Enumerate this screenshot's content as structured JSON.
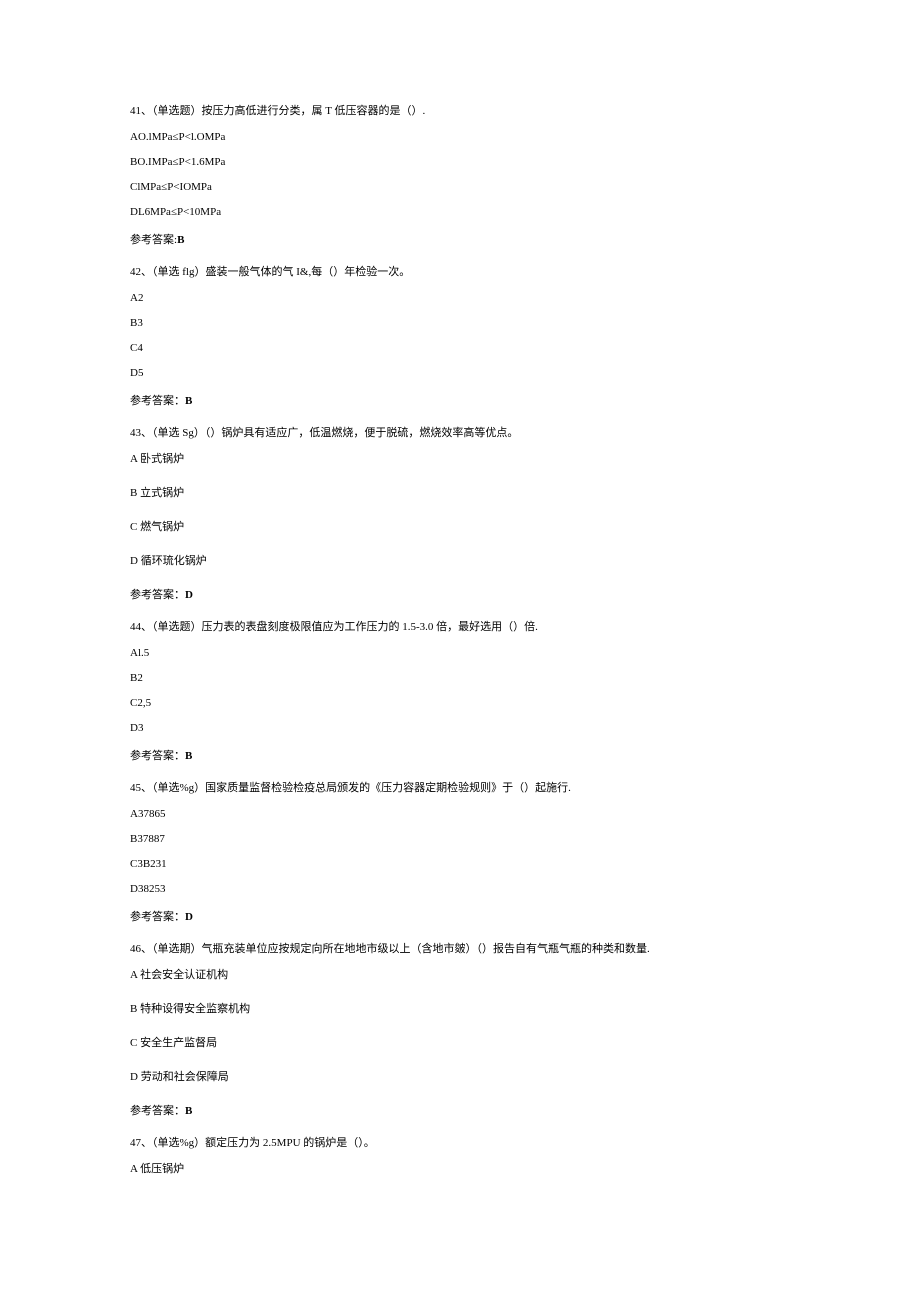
{
  "questions": [
    {
      "number": "41、",
      "type": "（单选题）",
      "text": "按压力高低进行分类，属 T 低压容器的是（）.",
      "options": [
        "AO.lMPa≤P<l.OMPa",
        "BO.IMPa≤P<1.6MPa",
        "ClMPa≤P<IOMPa",
        "DL6MPa≤P<10MPa"
      ],
      "answerLabel": "参考答案:",
      "answer": "B",
      "spaced": false
    },
    {
      "number": "42、",
      "type": "（单选 flg）",
      "text": "盛装一般气体的气 I&,每（）年检验一次。",
      "options": [
        "A2",
        "B3",
        "C4",
        "D5"
      ],
      "answerLabel": "参考答案：",
      "answer": "B",
      "spaced": false
    },
    {
      "number": "43、",
      "type": "（单选 Sg）",
      "text": "（）锅炉具有适应广，低温燃烧，便于脱硫，燃烧效率高等优点。",
      "options": [
        "A 卧式锅炉",
        "B 立式锅炉",
        "C 燃气锅炉",
        "D 循环琉化锅炉"
      ],
      "answerLabel": "参考答案：",
      "answer": "D",
      "spaced": true
    },
    {
      "number": "44、",
      "type": "（单选题）",
      "text": "压力表的表盘刻度极限值应为工作压力的 1.5-3.0 倍，最好选用（）倍.",
      "options": [
        "Al.5",
        "B2",
        "C2,5",
        "D3"
      ],
      "answerLabel": "参考答案：",
      "answer": "B",
      "spaced": false
    },
    {
      "number": "45、",
      "type": "（单选%g）",
      "text": "国家质量监督检验检疫总局颁发的《压力容器定期检验规则》于（）起施行.",
      "options": [
        "A37865",
        "B37887",
        "C3B231",
        "D38253"
      ],
      "answerLabel": "参考答案：",
      "answer": "D",
      "spaced": false
    },
    {
      "number": "46、",
      "type": "（单选期）",
      "text": "气瓶充装单位应按规定向所在地地市级以上（含地市皴）（）报告自有气瓶气瓶的种类和数量.",
      "options": [
        "A 社会安全认证机构",
        "B 特种设得安全监察机构",
        "C 安全生产监督局",
        "D 劳动和社会保障局"
      ],
      "answerLabel": "参考答案：",
      "answer": "B",
      "spaced": true
    },
    {
      "number": "47、",
      "type": "（单选%g）",
      "text": "额定压力为 2.5MPU 的锅炉是（）。",
      "options": [
        "A 低压锅炉"
      ],
      "answerLabel": "",
      "answer": "",
      "spaced": true
    }
  ]
}
